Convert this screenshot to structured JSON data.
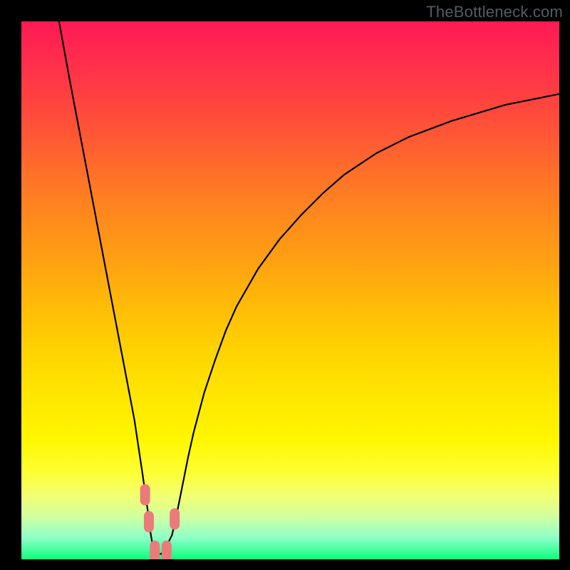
{
  "watermark": "TheBottleneck.com",
  "chart_data": {
    "type": "line",
    "title": "",
    "xlabel": "",
    "ylabel": "",
    "xlim": [
      0,
      100
    ],
    "ylim": [
      0,
      100
    ],
    "series": [
      {
        "name": "curve",
        "x": [
          7,
          9,
          11,
          13,
          15,
          17,
          19,
          21,
          22.5,
          23.5,
          24,
          24.5,
          25.5,
          26,
          26.5,
          27,
          28,
          29,
          30,
          31,
          32,
          34,
          36,
          38,
          40,
          44,
          48,
          52,
          56,
          60,
          66,
          72,
          80,
          90,
          100
        ],
        "y": [
          100,
          89,
          78.5,
          68,
          57.5,
          47,
          36.5,
          26,
          16,
          9,
          5,
          2,
          1,
          1,
          1.5,
          2.5,
          4.5,
          9,
          14,
          19,
          23.5,
          31,
          37,
          42.5,
          47,
          54,
          59.5,
          64,
          68,
          71.5,
          75.5,
          78.5,
          81.5,
          84.5,
          86.5
        ]
      }
    ],
    "markers": [
      {
        "x": 23.0,
        "y": 12.0
      },
      {
        "x": 23.7,
        "y": 7.0
      },
      {
        "x": 24.8,
        "y": 1.5
      },
      {
        "x": 27.0,
        "y": 1.5
      },
      {
        "x": 28.5,
        "y": 7.5
      }
    ],
    "marker_color": "#eb7b7b",
    "curve_color": "#000000",
    "background_gradient": [
      "#ff1a54",
      "#ff7626",
      "#ffd500",
      "#fff700",
      "#0eff7d"
    ]
  }
}
